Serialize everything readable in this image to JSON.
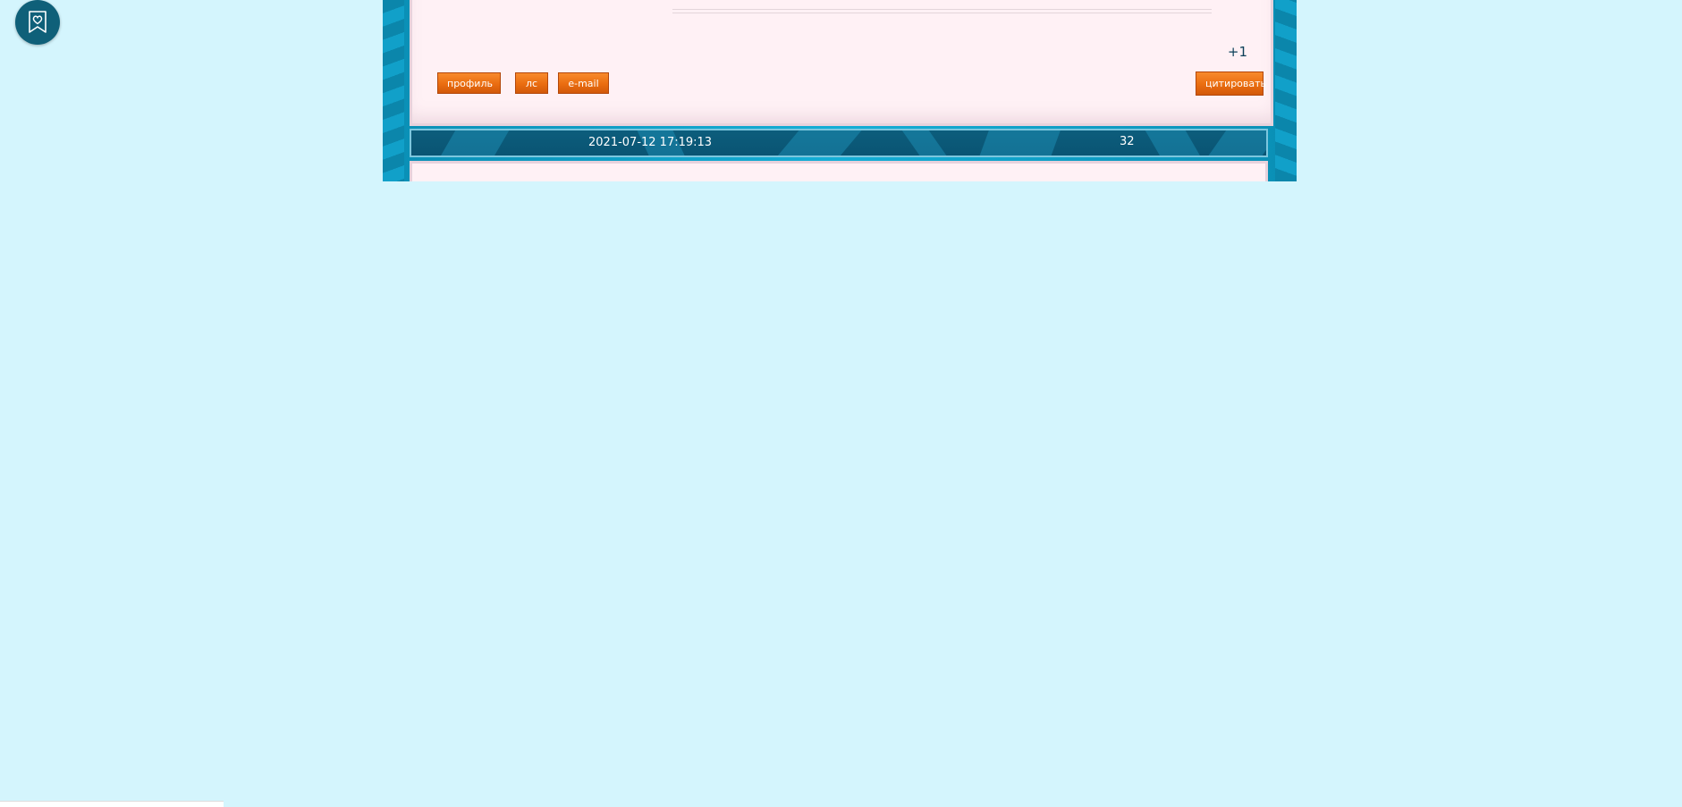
{
  "post_buttons": {
    "profile": "профиль",
    "pm": "лс",
    "email": "e-mail",
    "quote": "цитировать"
  },
  "rating": "+1",
  "next_post": {
    "date": "2021-07-12 17:19:13",
    "number": "32"
  },
  "icons": {
    "bookmark": "bookmark-heart-icon"
  },
  "colors": {
    "page_bg": "#d4f5fd",
    "frame": "#0a8fb5",
    "post_bg": "#fff1f5",
    "header_bg": "#0c5d7c",
    "button": "#ea6d10"
  }
}
